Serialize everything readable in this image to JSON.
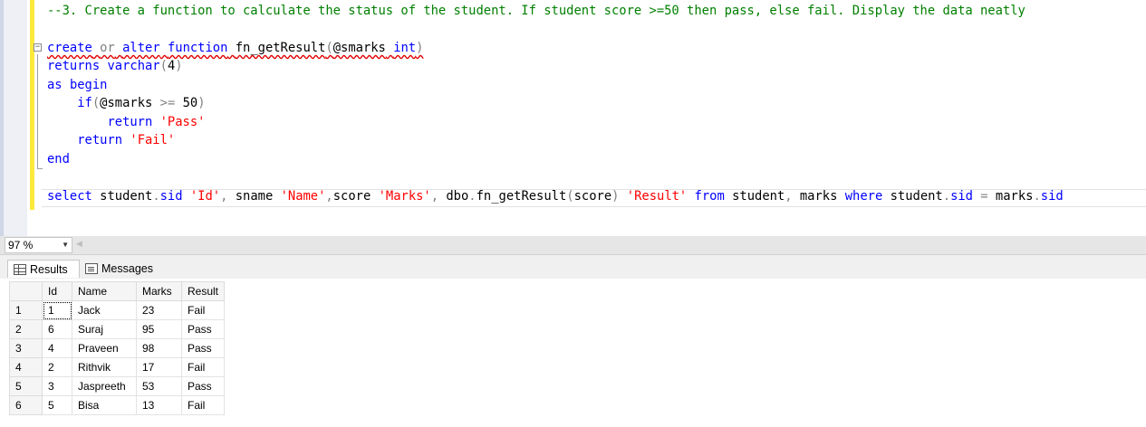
{
  "editor": {
    "comment_line": "--3. Create a function to calculate the status of the student. If student score >=50 then pass, else fail. Display the data neatly",
    "outline_toggle": "−",
    "tokens": {
      "create": "create",
      "or": "or",
      "alter": "alter",
      "function": "function",
      "fn_name": "fn_getResult",
      "param": "@smarks",
      "int": "int",
      "returns": "returns",
      "varchar": "varchar",
      "len": "4",
      "as": "as",
      "begin": "begin",
      "if": "if",
      "ge": ">=",
      "fifty": "50",
      "return": "return",
      "pass_str": "'Pass'",
      "fail_str": "'Fail'",
      "end": "end",
      "select": "select",
      "student": "student",
      "sid": "sid",
      "id_alias": "'Id'",
      "sname": "sname",
      "name_alias": "'Name'",
      "score": "score",
      "marks_alias": "'Marks'",
      "dbo": "dbo",
      "result_alias": "'Result'",
      "from": "from",
      "marks": "marks",
      "where": "where",
      "eq": "="
    }
  },
  "zoom": {
    "value": "97 %"
  },
  "tabs": {
    "results": "Results",
    "messages": "Messages"
  },
  "results": {
    "columns": [
      "Id",
      "Name",
      "Marks",
      "Result"
    ],
    "rows": [
      {
        "num": "1",
        "id": "1",
        "name": "Jack",
        "marks": "23",
        "result": "Fail"
      },
      {
        "num": "2",
        "id": "6",
        "name": "Suraj",
        "marks": "95",
        "result": "Pass"
      },
      {
        "num": "3",
        "id": "4",
        "name": "Praveen",
        "marks": "98",
        "result": "Pass"
      },
      {
        "num": "4",
        "id": "2",
        "name": "Rithvik",
        "marks": "17",
        "result": "Fail"
      },
      {
        "num": "5",
        "id": "3",
        "name": "Jaspreeth",
        "marks": "53",
        "result": "Pass"
      },
      {
        "num": "6",
        "id": "5",
        "name": "Bisa",
        "marks": "13",
        "result": "Fail"
      }
    ]
  },
  "colors": {
    "keyword": "#0000ff",
    "string": "#ff0000",
    "comment": "#008000",
    "function": "#ff00ff",
    "operator": "#808080"
  }
}
